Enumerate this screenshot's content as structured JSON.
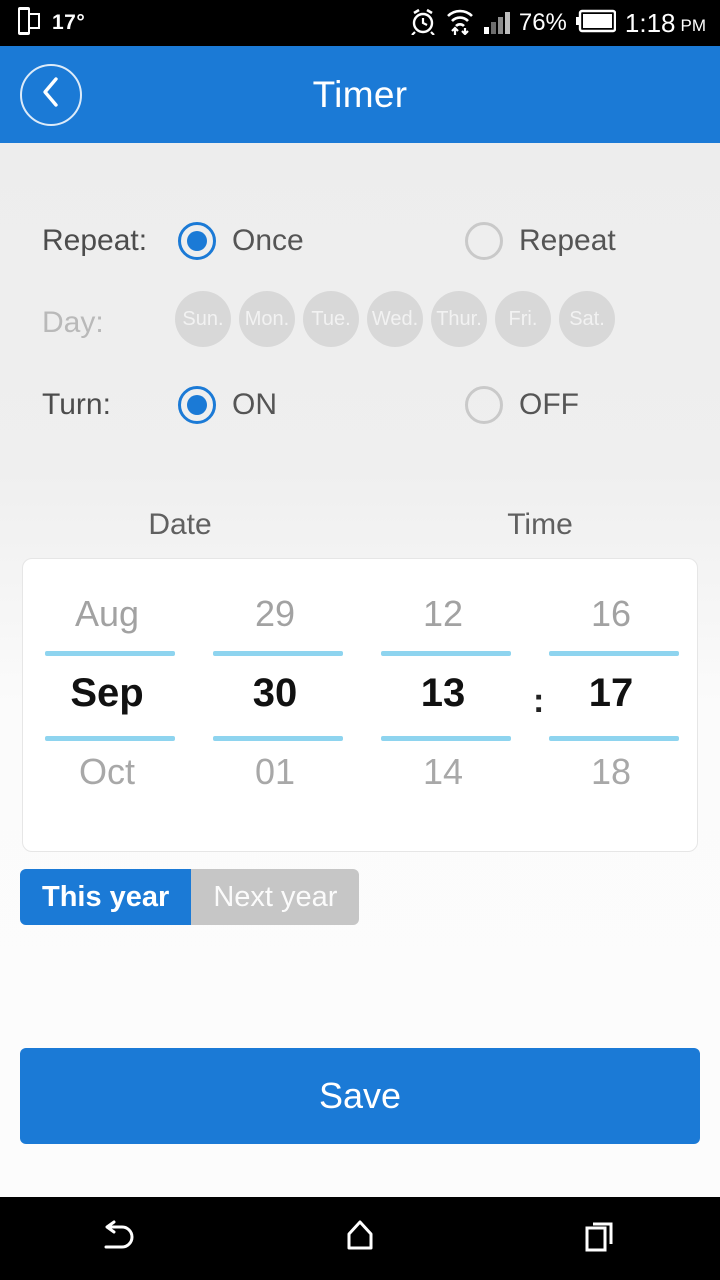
{
  "status_bar": {
    "cast_icon": "screen-mirror-icon",
    "temperature": "17°",
    "alarm_icon": "alarm-clock-icon",
    "wifi_icon": "wifi-transfer-icon",
    "signal_icon": "signal-bars-icon",
    "battery_percent": "76%",
    "battery_icon": "battery-icon",
    "time": "1:18",
    "am_pm": "PM"
  },
  "app_bar": {
    "back_icon": "chevron-left-icon",
    "title": "Timer"
  },
  "form": {
    "repeat": {
      "label": "Repeat:",
      "options": [
        {
          "label": "Once",
          "selected": true
        },
        {
          "label": "Repeat",
          "selected": false
        }
      ]
    },
    "day": {
      "label": "Day:",
      "disabled": true,
      "options": [
        "Sun.",
        "Mon.",
        "Tue.",
        "Wed.",
        "Thur.",
        "Fri.",
        "Sat."
      ]
    },
    "turn": {
      "label": "Turn:",
      "options": [
        {
          "label": "ON",
          "selected": true
        },
        {
          "label": "OFF",
          "selected": false
        }
      ]
    }
  },
  "picker": {
    "headers": {
      "date": "Date",
      "time": "Time"
    },
    "separator": ":",
    "month": {
      "prev": "Aug",
      "selected": "Sep",
      "next": "Oct"
    },
    "day": {
      "prev": "29",
      "selected": "30",
      "next": "01"
    },
    "hour": {
      "prev": "12",
      "selected": "13",
      "next": "14"
    },
    "minute": {
      "prev": "16",
      "selected": "17",
      "next": "18"
    }
  },
  "year_toggle": {
    "this_year": "This year",
    "next_year": "Next year",
    "selected": "This year"
  },
  "actions": {
    "save": "Save"
  },
  "nav_bar": {
    "back_icon": "nav-back-icon",
    "home_icon": "nav-home-icon",
    "recents_icon": "nav-recents-icon"
  },
  "colors": {
    "accent_blue": "#1b7ad6",
    "picker_line": "#8ed4ef",
    "disabled_gray": "#d8d8d8",
    "inactive_toggle": "#c6c6c6"
  }
}
